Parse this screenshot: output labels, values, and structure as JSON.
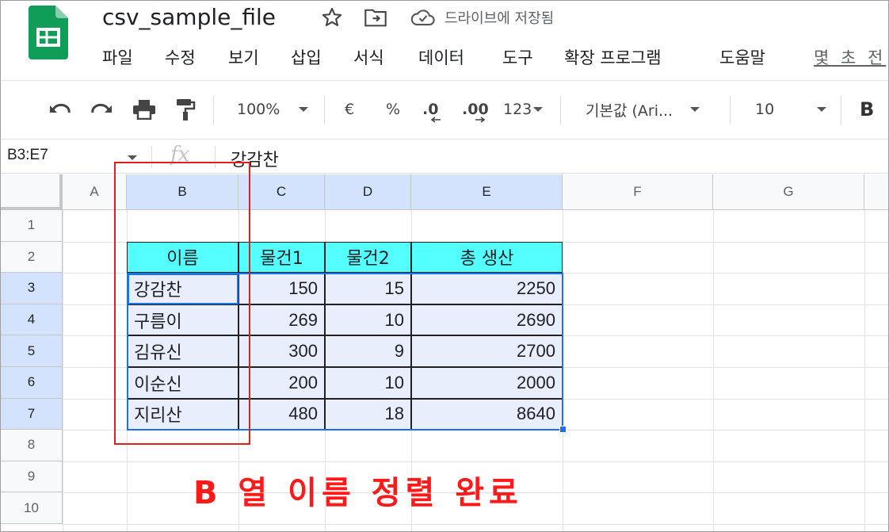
{
  "app": {
    "title": "csv_sample_file",
    "save_status": "드라이브에 저장됨",
    "last_edit": "몇 초 전",
    "brand_color": "#0f9d58"
  },
  "menu": [
    "파일",
    "수정",
    "보기",
    "삽입",
    "서식",
    "데이터",
    "도구",
    "확장 프로그램",
    "도움말"
  ],
  "toolbar": {
    "undo_icon": "undo-icon",
    "redo_icon": "redo-icon",
    "print_icon": "print-icon",
    "paint_format_icon": "paint-format-icon",
    "zoom": "100%",
    "currency": "€",
    "percent": "%",
    "decrease_decimal": ".0",
    "increase_decimal": ".00",
    "number_format": "123",
    "font": "기본값 (Ari...",
    "font_size": "10",
    "bold": "B"
  },
  "formula_bar": {
    "name_box": "B3:E7",
    "fx": "fx",
    "value": "강감찬"
  },
  "sheet": {
    "columns": [
      "A",
      "B",
      "C",
      "D",
      "E",
      "F",
      "G"
    ],
    "rows": [
      "1",
      "2",
      "3",
      "4",
      "5",
      "6",
      "7",
      "8",
      "9",
      "10"
    ],
    "header": [
      "이름",
      "물건1",
      "물건2",
      "총 생산"
    ],
    "data": [
      [
        "강감찬",
        "150",
        "15",
        "2250"
      ],
      [
        "구름이",
        "269",
        "10",
        "2690"
      ],
      [
        "김유신",
        "300",
        "9",
        "2700"
      ],
      [
        "이순신",
        "200",
        "10",
        "2000"
      ],
      [
        "지리산",
        "480",
        "18",
        "8640"
      ]
    ],
    "header_fill": "#53ffff",
    "selection_fill": "#e8eefc"
  },
  "annotation": "B 열 이름 정렬 완료"
}
